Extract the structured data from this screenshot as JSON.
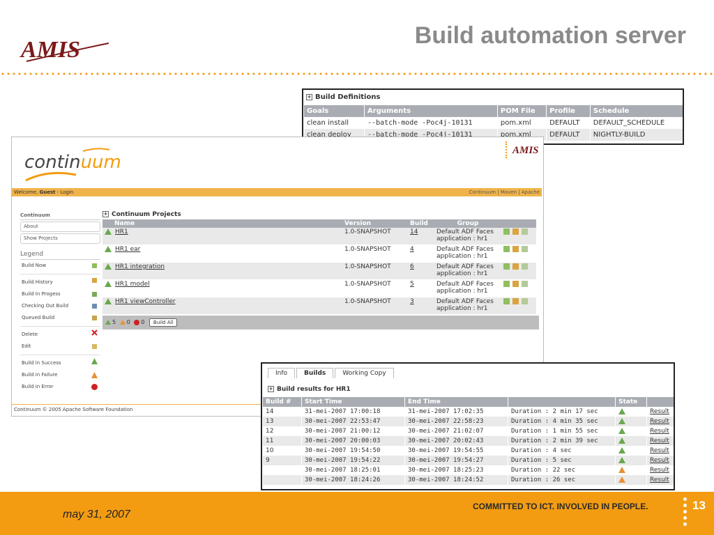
{
  "slide": {
    "title": "Build automation server",
    "logo_text": "AMIS",
    "date": "may 31, 2007",
    "tagline": "COMMITTED TO ICT. INVOLVED IN PEOPLE.",
    "page_number": "13",
    "accent_color": "#f39c12"
  },
  "build_definitions": {
    "title": "Build Definitions",
    "columns": [
      "Goals",
      "Arguments",
      "POM File",
      "Profile",
      "Schedule"
    ],
    "rows": [
      [
        "clean install",
        "--batch-mode -Poc4j-10131",
        "pom.xml",
        "DEFAULT",
        "DEFAULT_SCHEDULE"
      ],
      [
        "clean deploy",
        "--batch-mode -Poc4j-10131",
        "pom.xml",
        "DEFAULT",
        "NIGHTLY-BUILD"
      ]
    ]
  },
  "continuum": {
    "logo_prefix": "contin",
    "logo_highlight": "uum",
    "logo_badge": "AMIS",
    "welcome": "Welcome, ",
    "guest": "Guest",
    "login": "Login",
    "top_links": "Continuum | Maven | Apache",
    "sidebar": {
      "heading": "Continuum",
      "about": "About",
      "show_projects": "Show Projects",
      "legend_heading": "Legend",
      "legend": [
        {
          "label": "Build Now",
          "icon": "build-now-icon"
        },
        {
          "label": "Build History",
          "icon": "build-history-icon"
        },
        {
          "label": "Build In Progess",
          "icon": "build-in-progress-icon"
        },
        {
          "label": "Checking Out Build",
          "icon": "checkout-icon"
        },
        {
          "label": "Queued Build",
          "icon": "queued-icon"
        },
        {
          "label": "Delete",
          "icon": "delete-icon"
        },
        {
          "label": "Edit",
          "icon": "edit-icon"
        },
        {
          "label": "Build in Success",
          "icon": "success-icon"
        },
        {
          "label": "Build in Failure",
          "icon": "failure-icon"
        },
        {
          "label": "Build in Error",
          "icon": "error-icon"
        }
      ]
    },
    "projects": {
      "title": "Continuum Projects",
      "columns": [
        "Name",
        "Version",
        "Build",
        "Group"
      ],
      "rows": [
        {
          "name": "HR1",
          "version": "1.0-SNAPSHOT",
          "build": "14",
          "group": "Default ADF Faces application : hr1"
        },
        {
          "name": "HR1 ear",
          "version": "1.0-SNAPSHOT",
          "build": "4",
          "group": "Default ADF Faces application : hr1"
        },
        {
          "name": "HR1 integration",
          "version": "1.0-SNAPSHOT",
          "build": "6",
          "group": "Default ADF Faces application : hr1"
        },
        {
          "name": "HR1 model",
          "version": "1.0-SNAPSHOT",
          "build": "5",
          "group": "Default ADF Faces application : hr1"
        },
        {
          "name": "HR1 viewController",
          "version": "1.0-SNAPSHOT",
          "build": "3",
          "group": "Default ADF Faces application : hr1"
        }
      ],
      "summary": {
        "success": "5",
        "failure": "0",
        "error": "0"
      },
      "build_all": "Build All"
    },
    "footer": "Continuum © 2005 Apache Software Foundation"
  },
  "build_results": {
    "tabs": [
      "Info",
      "Builds",
      "Working Copy"
    ],
    "active_tab": "Builds",
    "title": "Build results for HR1",
    "columns": [
      "Build #",
      "Start Time",
      "End Time",
      "",
      "State",
      ""
    ],
    "rows": [
      {
        "build": "14",
        "start": "31-mei-2007 17:00:18",
        "end": "31-mei-2007 17:02:35",
        "duration": "Duration : 2 min 17 sec",
        "state": "success",
        "link": "Result"
      },
      {
        "build": "13",
        "start": "30-mei-2007 22:53:47",
        "end": "30-mei-2007 22:58:23",
        "duration": "Duration : 4 min 35 sec",
        "state": "success",
        "link": "Result"
      },
      {
        "build": "12",
        "start": "30-mei-2007 21:00:12",
        "end": "30-mei-2007 21:02:07",
        "duration": "Duration : 1 min 55 sec",
        "state": "success",
        "link": "Result"
      },
      {
        "build": "11",
        "start": "30-mei-2007 20:00:03",
        "end": "30-mei-2007 20:02:43",
        "duration": "Duration : 2 min 39 sec",
        "state": "success",
        "link": "Result"
      },
      {
        "build": "10",
        "start": "30-mei-2007 19:54:50",
        "end": "30-mei-2007 19:54:55",
        "duration": "Duration : 4 sec",
        "state": "success",
        "link": "Result"
      },
      {
        "build": "9",
        "start": "30-mei-2007 19:54:22",
        "end": "30-mei-2007 19:54:27",
        "duration": "Duration : 5 sec",
        "state": "success",
        "link": "Result"
      },
      {
        "build": "",
        "start": "30-mei-2007 18:25:01",
        "end": "30-mei-2007 18:25:23",
        "duration": "Duration : 22 sec",
        "state": "failure",
        "link": "Result"
      },
      {
        "build": "",
        "start": "30-mei-2007 18:24:26",
        "end": "30-mei-2007 18:24:52",
        "duration": "Duration : 26 sec",
        "state": "failure",
        "link": "Result"
      }
    ]
  }
}
